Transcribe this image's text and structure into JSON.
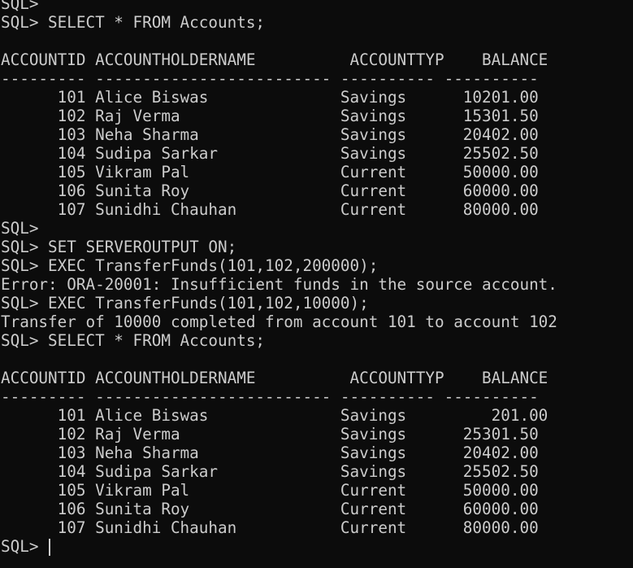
{
  "terminal": {
    "lines": [
      "SQL>",
      "SQL> SELECT * FROM Accounts;",
      "",
      "ACCOUNTID ACCOUNTHOLDERNAME          ACCOUNTTYP    BALANCE",
      "--------- ------------------------- ---------- ----------",
      "      101 Alice Biswas              Savings      10201.00",
      "      102 Raj Verma                 Savings      15301.50",
      "      103 Neha Sharma               Savings      20402.00",
      "      104 Sudipa Sarkar             Savings      25502.50",
      "      105 Vikram Pal                Current      50000.00",
      "      106 Sunita Roy                Current      60000.00",
      "      107 Sunidhi Chauhan           Current      80000.00",
      "SQL>",
      "SQL> SET SERVEROUTPUT ON;",
      "SQL> EXEC TransferFunds(101,102,200000);",
      "Error: ORA-20001: Insufficient funds in the source account.",
      "SQL> EXEC TransferFunds(101,102,10000);",
      "Transfer of 10000 completed from account 101 to account 102",
      "SQL> SELECT * FROM Accounts;",
      "",
      "ACCOUNTID ACCOUNTHOLDERNAME          ACCOUNTTYP    BALANCE",
      "--------- ------------------------- ---------- ----------",
      "      101 Alice Biswas              Savings         201.00",
      "      102 Raj Verma                 Savings      25301.50",
      "      103 Neha Sharma               Savings      20402.00",
      "      104 Sudipa Sarkar             Savings      25502.50",
      "      105 Vikram Pal                Current      50000.00",
      "      106 Sunita Roy                Current      60000.00",
      "      107 Sunidhi Chauhan           Current      80000.00"
    ],
    "prompt": "SQL> "
  },
  "colors": {
    "background": "#0c0c0c",
    "foreground": "#cccccc"
  }
}
